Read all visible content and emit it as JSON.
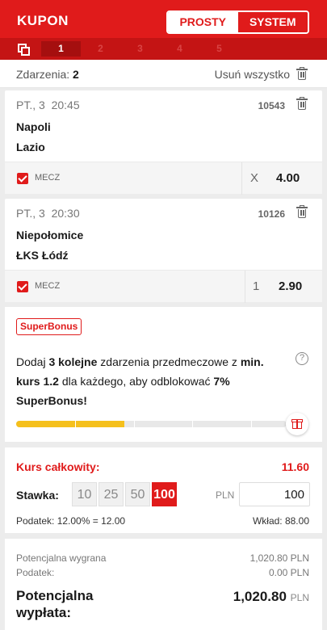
{
  "header": {
    "title": "KUPON",
    "tabs": [
      {
        "label": "PROSTY",
        "active": true
      },
      {
        "label": "SYSTEM",
        "active": false
      }
    ]
  },
  "coupon_tabs": [
    "1",
    "2",
    "3",
    "4",
    "5"
  ],
  "coupon_tab_active": "1",
  "events_bar": {
    "label": "Zdarzenia:",
    "count": "2",
    "remove_all": "Usuń wszystko"
  },
  "events": [
    {
      "date": "PT., 3",
      "time": "20:45",
      "code": "10543",
      "home": "Napoli",
      "away": "Lazio",
      "market": "MECZ",
      "pick": "X",
      "odd": "4.00"
    },
    {
      "date": "PT., 3",
      "time": "20:30",
      "code": "10126",
      "home": "Niepołomice",
      "away": "ŁKS Łódź",
      "market": "MECZ",
      "pick": "1",
      "odd": "2.90"
    }
  ],
  "superbonus": {
    "badge": "SuperBonus",
    "text_1": "Dodaj ",
    "bold_1": "3 kolejne",
    "text_2": " zdarzenia przedmeczowe z ",
    "bold_2": "min. kurs 1.2",
    "text_3": " dla każdego, aby odblokować ",
    "bold_3": "7% SuperBonus!",
    "help": "?",
    "progress_fraction": 0.4
  },
  "stake": {
    "total_label": "Kurs całkowity:",
    "total_value": "11.60",
    "stake_label": "Stawka:",
    "chips": [
      "10",
      "25",
      "50",
      "100"
    ],
    "chip_active": "100",
    "currency": "PLN",
    "amount": "100",
    "tax_text": "Podatek: 12.00% = 12.00",
    "deposit_text": "Wkład: 88.00"
  },
  "summary": {
    "potential_win_label": "Potencjalna wygrana",
    "potential_win_value": "1,020.80",
    "tax_label": "Podatek:",
    "tax_value": "0.00",
    "currency": "PLN",
    "payout_label_1": "Potencjalna",
    "payout_label_2": "wypłata:",
    "payout_value": "1,020.80"
  },
  "colors": {
    "brand_red": "#e01b1b",
    "progress_yellow": "#f5c01c"
  }
}
